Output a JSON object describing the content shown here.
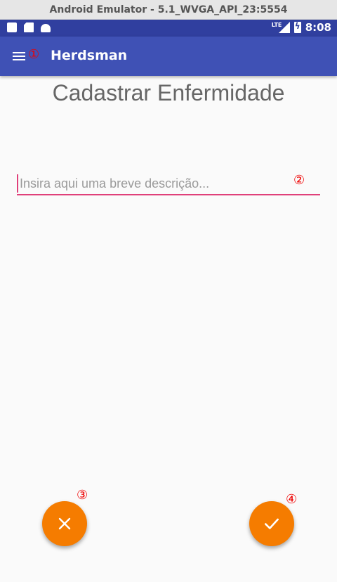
{
  "window": {
    "title": "Android Emulator - 5.1_WVGA_API_23:5554"
  },
  "status_bar": {
    "network": "LTE",
    "time": "8:08",
    "icons": [
      "notification-icon",
      "sd-card-icon",
      "android-icon",
      "signal-icon",
      "battery-charging-icon"
    ]
  },
  "app_bar": {
    "title": "Herdsman",
    "menu_icon": "hamburger-menu-icon"
  },
  "annotations": [
    "①",
    "②",
    "③",
    "④"
  ],
  "page": {
    "title": "Cadastrar Enfermidade"
  },
  "form": {
    "description": {
      "value": "",
      "placeholder": "Insira aqui uma breve descrição..."
    }
  },
  "actions": {
    "cancel_icon": "close-icon",
    "confirm_icon": "check-icon"
  },
  "colors": {
    "status_bar": "#303f9f",
    "app_bar": "#3f51b5",
    "accent": "#e0407a",
    "fab": "#f57c00",
    "annotation": "#e00000"
  }
}
